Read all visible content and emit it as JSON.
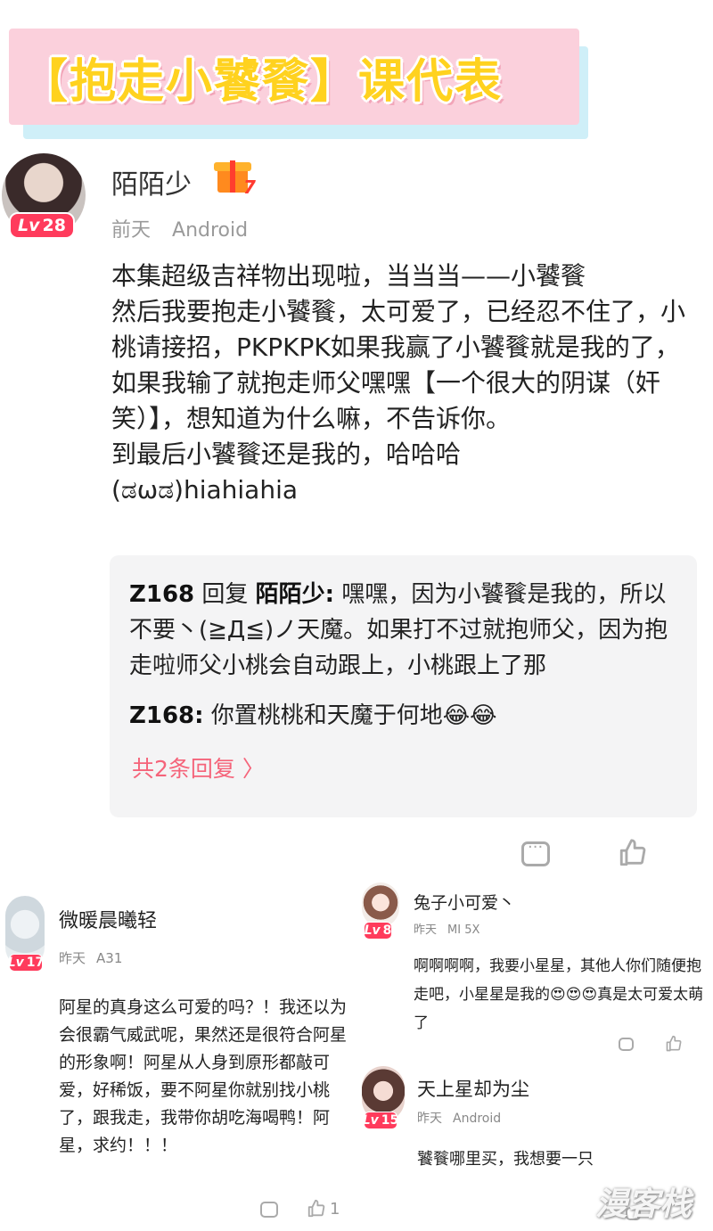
{
  "banner": {
    "title": "【抱走小饕餮】课代表"
  },
  "main_comment": {
    "username": "陌陌少",
    "level": "28",
    "lv_prefix": "Lv",
    "gift_count": "7",
    "time": "前天",
    "device": "Android",
    "text": "本集超级吉祥物出现啦，当当当——小饕餮\n然后我要抱走小饕餮，太可爱了，已经忍不住了，小桃请接招，PKPKPK如果我赢了小饕餮就是我的了，如果我输了就抱走师父嘿嘿【一个很大的阴谋（奸笑）】，想知道为什么嘛，不告诉你。\n到最后小饕餮还是我的，哈哈哈\n(ಡωಡ)hiahiahia",
    "replies": [
      {
        "user": "Z168",
        "action": "回复",
        "target": "陌陌少:",
        "text": "嘿嘿，因为小饕餮是我的，所以不要丶(≧Д≦)ノ天魔。如果打不过就抱师父，因为抱走啦师父小桃会自动跟上，小桃跟上了那"
      },
      {
        "user": "Z168:",
        "text": "你置桃桃和天魔于何地😂😂"
      }
    ],
    "more_replies": "共2条回复 〉"
  },
  "comment_left": {
    "username": "微暖晨曦轻",
    "level": "17",
    "lv_prefix": "Lv",
    "time": "昨天",
    "device": "A31",
    "text": "阿星的真身这么可爱的吗？！我还以为会很霸气威武呢，果然还是很符合阿星的形象啊！阿星从人身到原形都敲可爱，好稀饭，要不阿星你就别找小桃了，跟我走，我带你胡吃海喝鸭！阿星，求约！！！",
    "like_count": "1"
  },
  "comment_right_1": {
    "username": "兔子小可爱丶",
    "level": "8",
    "lv_prefix": "Lv",
    "time": "昨天",
    "device": "MI 5X",
    "text": "啊啊啊啊，我要小星星，其他人你们随便抱走吧，小星星是我的😍😍😍真是太可爱太萌了"
  },
  "comment_right_2": {
    "username": "天上星却为尘",
    "level": "15",
    "lv_prefix": "Lv",
    "time": "昨天",
    "device": "Android",
    "text": "饕餮哪里买，我想要一只"
  },
  "watermark": "漫客栈",
  "icons": {
    "comment": "comment-icon",
    "like": "thumbs-up-icon",
    "gift": "gift-icon"
  },
  "colors": {
    "level_badge": "#ff3b5c",
    "more_replies": "#f5647a",
    "banner_bg": "#fbd0dc",
    "banner_text": "#ffd21f"
  }
}
